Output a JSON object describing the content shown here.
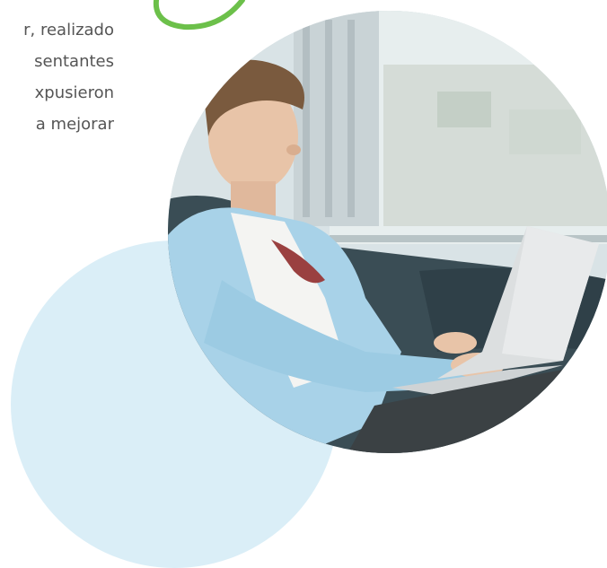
{
  "paragraph": {
    "lines": [
      "r, realizado",
      "sentantes",
      "xpusieron",
      "a  mejorar"
    ]
  },
  "colors": {
    "text": "#555555",
    "accent_green": "#6cc04a",
    "light_circle": "#daeef7"
  },
  "image": {
    "subject_icon": "man-with-laptop-photo"
  }
}
